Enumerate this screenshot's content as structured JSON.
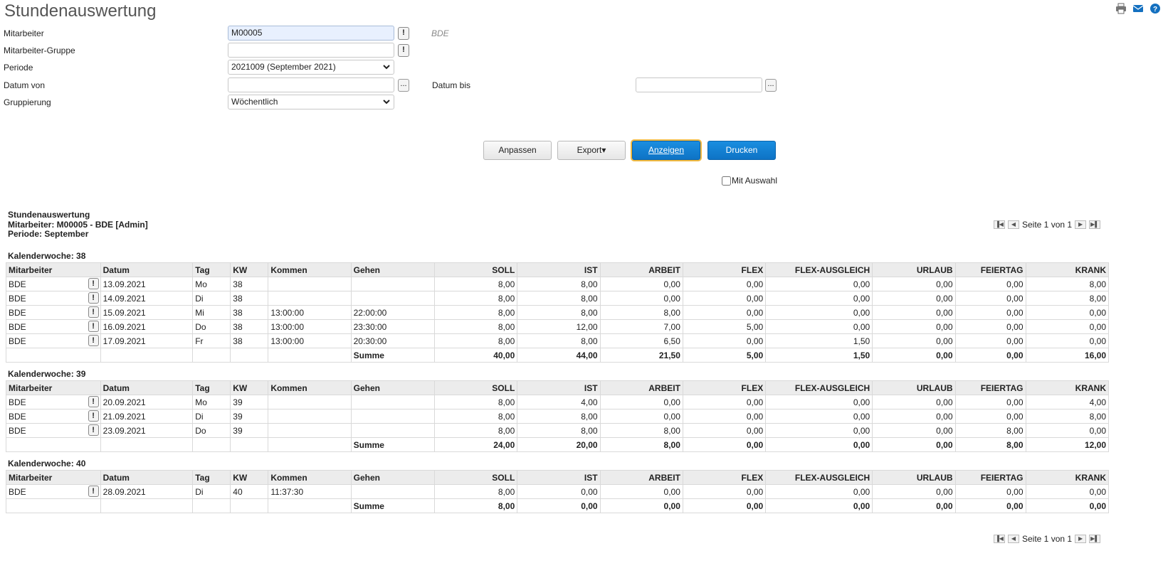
{
  "page": {
    "title": "Stundenauswertung"
  },
  "icons": {
    "print": "printer-icon",
    "mail": "mail-icon",
    "help": "help-icon"
  },
  "form": {
    "mitarbeiter_label": "Mitarbeiter",
    "mitarbeiter_value": "M00005",
    "mitarbeiter_name": "BDE",
    "gruppe_label": "Mitarbeiter-Gruppe",
    "gruppe_value": "",
    "periode_label": "Periode",
    "periode_value": "2021009 (September 2021)",
    "datum_von_label": "Datum von",
    "datum_von_value": "",
    "datum_bis_label": "Datum bis",
    "datum_bis_value": "",
    "gruppierung_label": "Gruppierung",
    "gruppierung_value": "Wöchentlich",
    "dots": "...",
    "excl": "!"
  },
  "buttons": {
    "anpassen": "Anpassen",
    "export": "Export▾",
    "anzeigen": "Anzeigen",
    "drucken": "Drucken"
  },
  "mit_auswahl": "Mit Auswahl",
  "report": {
    "line1": "Stundenauswertung",
    "line2": "Mitarbeiter: M00005 - BDE [Admin]",
    "line3": "Periode: September"
  },
  "pager": {
    "text": "Seite 1 von 1"
  },
  "columns": [
    "Mitarbeiter",
    "Datum",
    "Tag",
    "KW",
    "Kommen",
    "Gehen",
    "SOLL",
    "IST",
    "ARBEIT",
    "FLEX",
    "FLEX-AUSGLEICH",
    "URLAUB",
    "FEIERTAG",
    "KRANK"
  ],
  "weeks": [
    {
      "label": "Kalenderwoche: 38",
      "rows": [
        [
          "BDE",
          "13.09.2021",
          "Mo",
          "38",
          "",
          "",
          "8,00",
          "8,00",
          "0,00",
          "0,00",
          "0,00",
          "0,00",
          "0,00",
          "8,00"
        ],
        [
          "BDE",
          "14.09.2021",
          "Di",
          "38",
          "",
          "",
          "8,00",
          "8,00",
          "0,00",
          "0,00",
          "0,00",
          "0,00",
          "0,00",
          "8,00"
        ],
        [
          "BDE",
          "15.09.2021",
          "Mi",
          "38",
          "13:00:00",
          "22:00:00",
          "8,00",
          "8,00",
          "8,00",
          "0,00",
          "0,00",
          "0,00",
          "0,00",
          "0,00"
        ],
        [
          "BDE",
          "16.09.2021",
          "Do",
          "38",
          "13:00:00",
          "23:30:00",
          "8,00",
          "12,00",
          "7,00",
          "5,00",
          "0,00",
          "0,00",
          "0,00",
          "0,00"
        ],
        [
          "BDE",
          "17.09.2021",
          "Fr",
          "38",
          "13:00:00",
          "20:30:00",
          "8,00",
          "8,00",
          "6,50",
          "0,00",
          "1,50",
          "0,00",
          "0,00",
          "0,00"
        ]
      ],
      "sum": [
        "",
        "",
        "",
        "",
        "",
        "Summe",
        "40,00",
        "44,00",
        "21,50",
        "5,00",
        "1,50",
        "0,00",
        "0,00",
        "16,00"
      ]
    },
    {
      "label": "Kalenderwoche: 39",
      "rows": [
        [
          "BDE",
          "20.09.2021",
          "Mo",
          "39",
          "",
          "",
          "8,00",
          "4,00",
          "0,00",
          "0,00",
          "0,00",
          "0,00",
          "0,00",
          "4,00"
        ],
        [
          "BDE",
          "21.09.2021",
          "Di",
          "39",
          "",
          "",
          "8,00",
          "8,00",
          "0,00",
          "0,00",
          "0,00",
          "0,00",
          "0,00",
          "8,00"
        ],
        [
          "BDE",
          "23.09.2021",
          "Do",
          "39",
          "",
          "",
          "8,00",
          "8,00",
          "8,00",
          "0,00",
          "0,00",
          "0,00",
          "8,00",
          "0,00"
        ]
      ],
      "sum": [
        "",
        "",
        "",
        "",
        "",
        "Summe",
        "24,00",
        "20,00",
        "8,00",
        "0,00",
        "0,00",
        "0,00",
        "8,00",
        "12,00"
      ]
    },
    {
      "label": "Kalenderwoche: 40",
      "rows": [
        [
          "BDE",
          "28.09.2021",
          "Di",
          "40",
          "11:37:30",
          "",
          "8,00",
          "0,00",
          "0,00",
          "0,00",
          "0,00",
          "0,00",
          "0,00",
          "0,00"
        ]
      ],
      "sum": [
        "",
        "",
        "",
        "",
        "",
        "Summe",
        "8,00",
        "0,00",
        "0,00",
        "0,00",
        "0,00",
        "0,00",
        "0,00",
        "0,00"
      ]
    }
  ]
}
